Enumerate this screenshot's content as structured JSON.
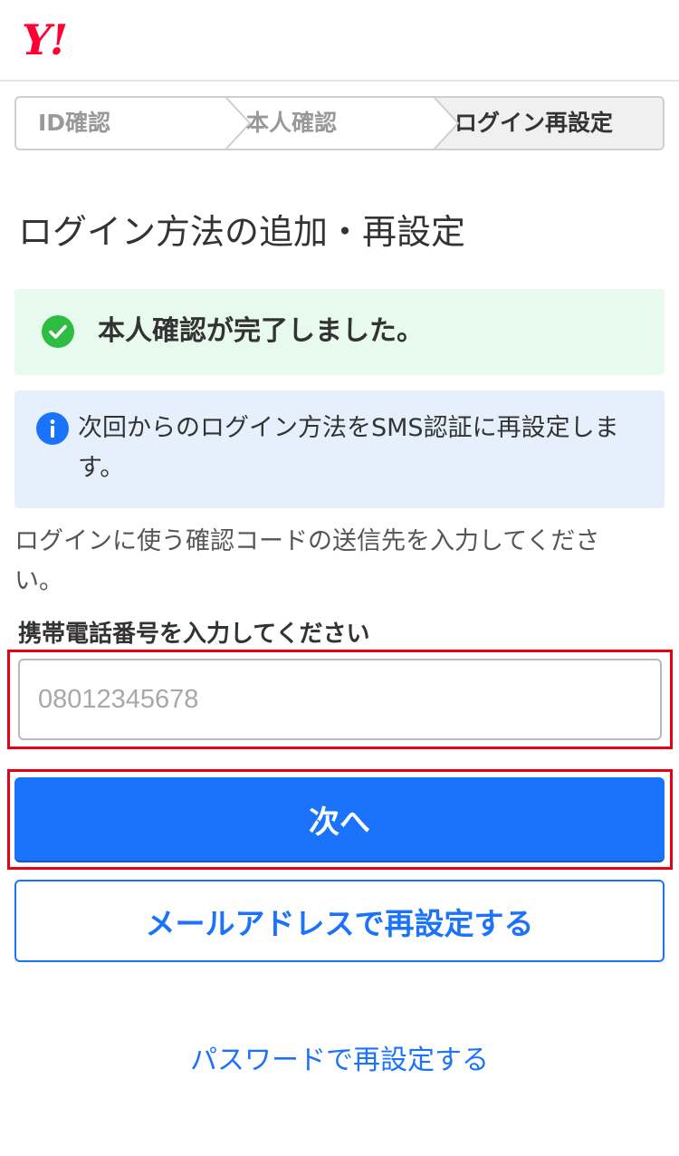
{
  "header": {
    "logo_text": "Y!"
  },
  "stepper": {
    "steps": [
      {
        "label": "ID確認",
        "state": "done"
      },
      {
        "label": "本人確認",
        "state": "done"
      },
      {
        "label": "ログイン再設定",
        "state": "current"
      }
    ]
  },
  "main": {
    "title": "ログイン方法の追加・再設定",
    "success_message": "本人確認が完了しました。",
    "info_message": "次回からのログイン方法をSMS認証に再設定します。",
    "description": "ログインに使う確認コードの送信先を入力してください。",
    "phone_label": "携帯電話番号を入力してください",
    "phone_value": "",
    "phone_placeholder": "08012345678",
    "next_button": "次へ",
    "email_button": "メールアドレスで再設定する",
    "password_link": "パスワードで再設定する"
  },
  "colors": {
    "brand_red": "#ff0033",
    "primary_blue": "#1a73fa",
    "success_bg": "#e8f9ed",
    "success_icon": "#2ebd42",
    "info_bg": "#e6f0fc",
    "info_icon": "#1a73fa",
    "highlight_red": "#e60012"
  },
  "icons": {
    "success": "check-circle-icon",
    "info": "info-circle-icon",
    "step_separator": "chevron-right-icon"
  }
}
